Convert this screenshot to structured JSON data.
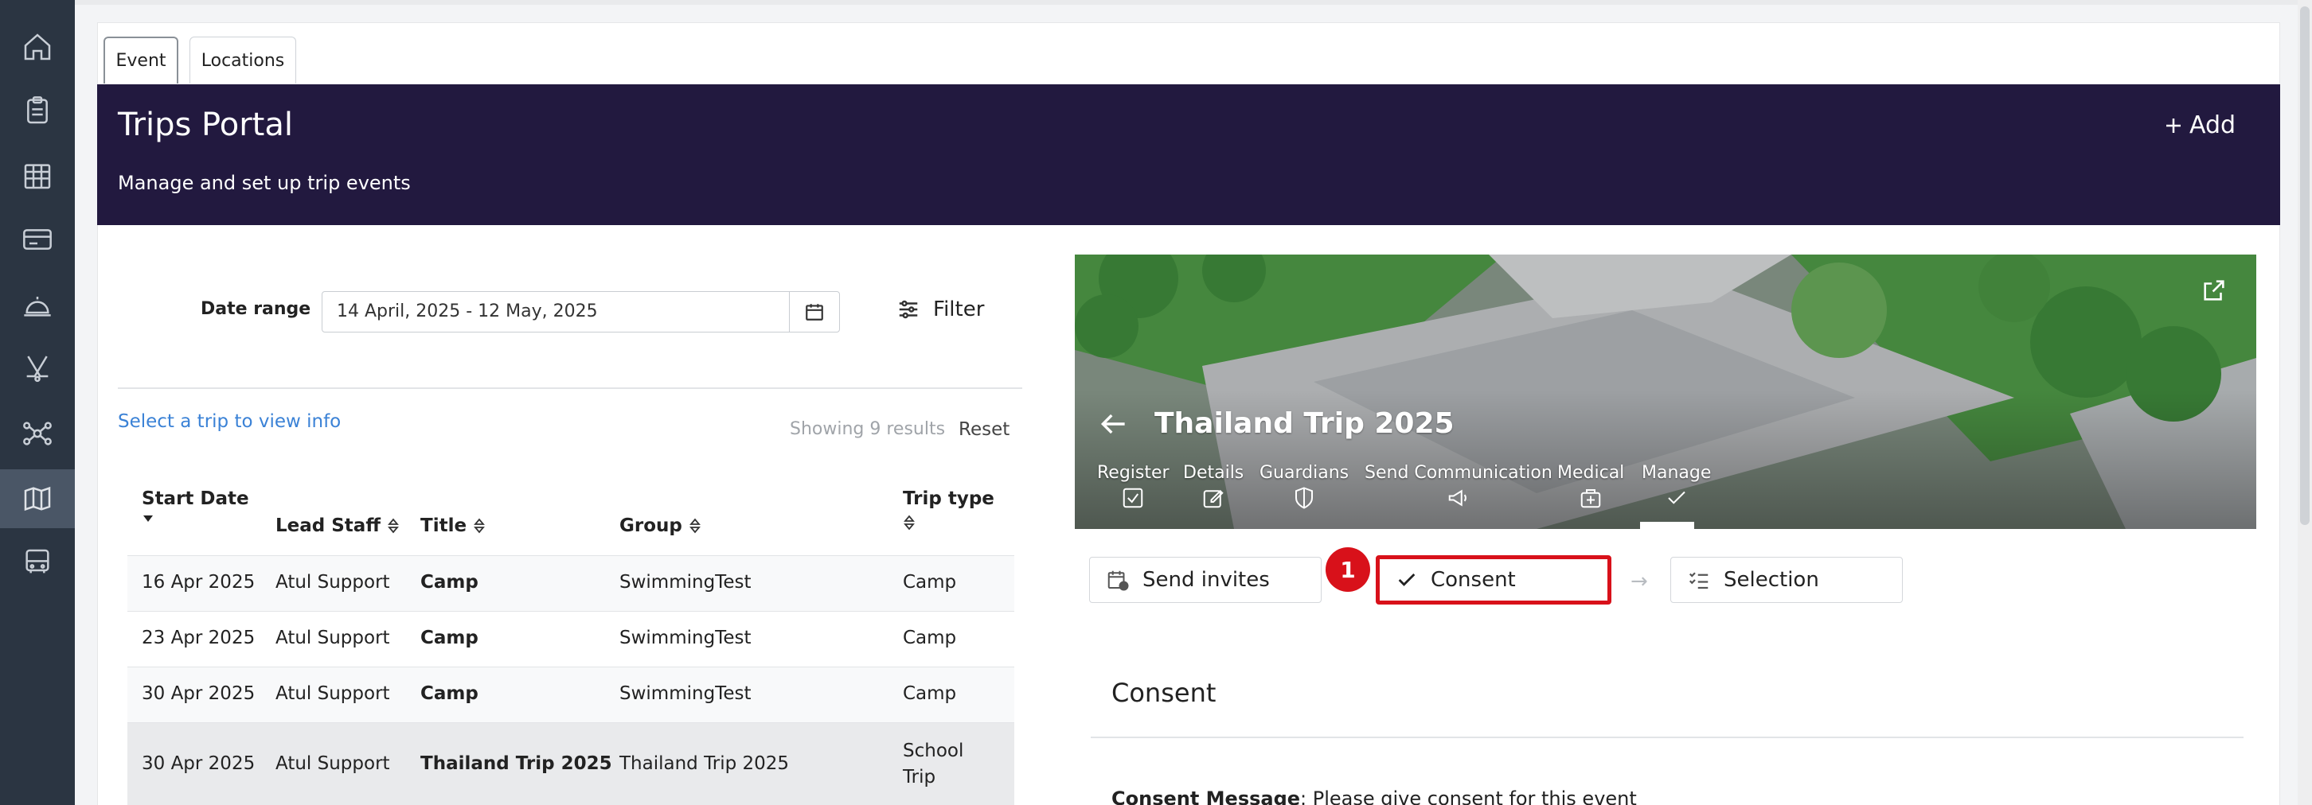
{
  "tabs": [
    {
      "label": "Event"
    },
    {
      "label": "Locations"
    }
  ],
  "header": {
    "title": "Trips Portal",
    "subtitle": "Manage and set up trip events",
    "add_label": "Add"
  },
  "filters": {
    "date_range_label": "Date range",
    "date_range_value": "14 April, 2025 - 12 May, 2025",
    "filter_label": "Filter"
  },
  "list": {
    "select_prompt": "Select a trip to view info",
    "showing": "Showing 9 results",
    "reset": "Reset",
    "columns": [
      "Start Date",
      "Lead Staff",
      "Title",
      "Group",
      "Trip type"
    ],
    "rows": [
      {
        "start": "16 Apr 2025",
        "staff": "Atul Support",
        "title": "Camp",
        "group": "SwimmingTest",
        "type": "Camp"
      },
      {
        "start": "23 Apr 2025",
        "staff": "Atul Support",
        "title": "Camp",
        "group": "SwimmingTest",
        "type": "Camp"
      },
      {
        "start": "30 Apr 2025",
        "staff": "Atul Support",
        "title": "Camp",
        "group": "SwimmingTest",
        "type": "Camp"
      },
      {
        "start": "30 Apr 2025",
        "staff": "Atul Support",
        "title": "Thailand Trip 2025",
        "group": "Thailand Trip 2025",
        "type_line1": "School",
        "type_line2": "Trip"
      }
    ]
  },
  "detail": {
    "title": "Thailand Trip 2025",
    "nav": [
      "Register",
      "Details",
      "Guardians",
      "Send Communication",
      "Medical",
      "Manage"
    ],
    "steps": [
      "Send invites",
      "Consent",
      "Selection"
    ],
    "step_badge": "1",
    "section_title": "Consent",
    "consent_label": "Consent Message",
    "consent_text": ": Please give consent for this event"
  },
  "colors": {
    "sidebar": "#2b3542",
    "header": "#22193f",
    "link": "#3b82d6",
    "highlight": "#d8111a"
  }
}
